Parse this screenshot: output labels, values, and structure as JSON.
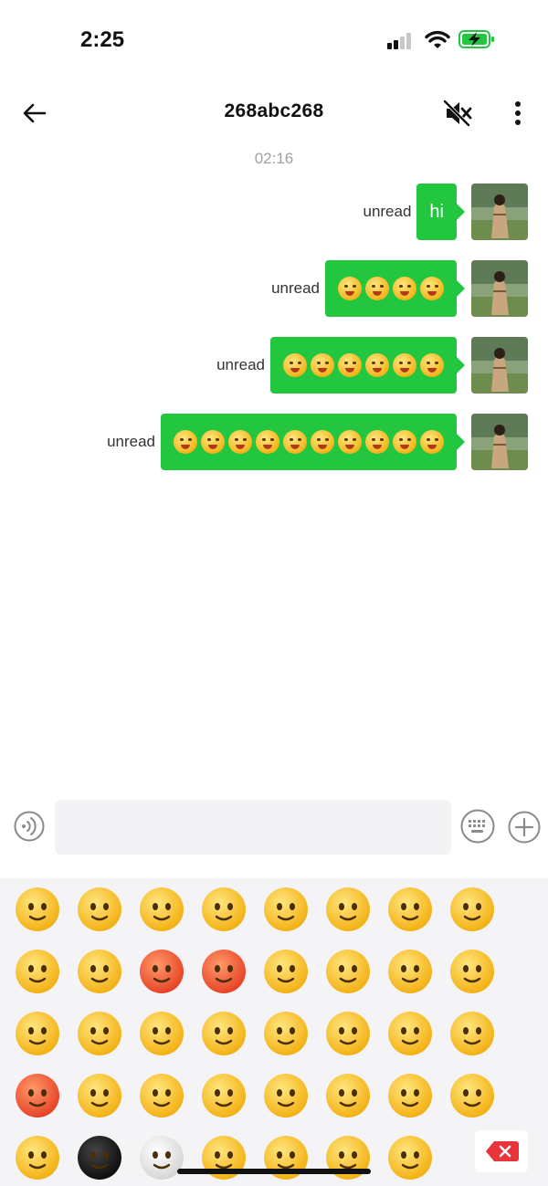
{
  "status_bar": {
    "time": "2:25",
    "battery_state": "charging"
  },
  "nav": {
    "title": "268abc268",
    "back_icon": "arrow-left-icon",
    "mute_icon": "speaker-muted-icon",
    "more_icon": "more-vertical-icon"
  },
  "conversation": {
    "timestamp": "02:16",
    "messages": [
      {
        "status": "unread",
        "type": "text",
        "text": "hi"
      },
      {
        "status": "unread",
        "type": "emoji",
        "emoji_count": 4
      },
      {
        "status": "unread",
        "type": "emoji",
        "emoji_count": 6
      },
      {
        "status": "unread",
        "type": "emoji",
        "emoji_count": 10
      }
    ]
  },
  "input_bar": {
    "placeholder": "",
    "voice_icon": "voice-icon",
    "keyboard_icon": "keyboard-icon",
    "plus_icon": "plus-icon"
  },
  "emoji_panel": {
    "rows": 5,
    "columns": 8,
    "delete_icon": "backspace-icon"
  },
  "colors": {
    "bubble": "#22c73f",
    "accent_red": "#e8343a",
    "panel_bg": "#f4f4f6"
  }
}
